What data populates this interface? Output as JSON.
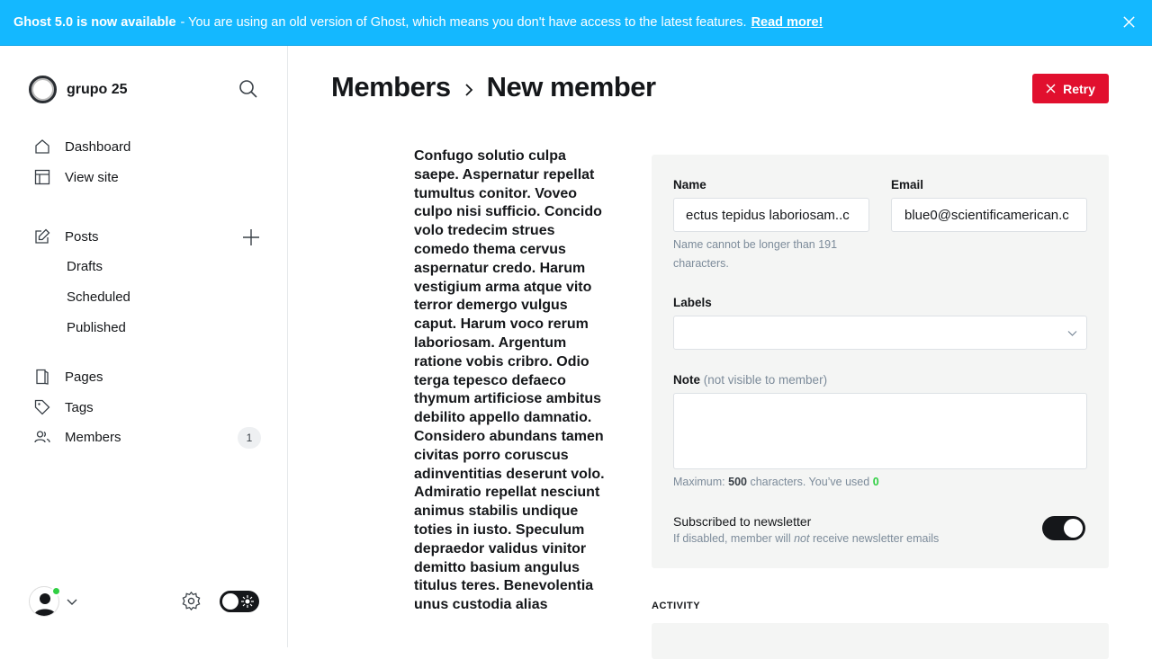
{
  "banner": {
    "title": "Ghost 5.0 is now available",
    "message": "- You are using an old version of Ghost, which means you don't have access to the latest features.",
    "link": "Read more!"
  },
  "sidebar": {
    "site_name": "grupo 25",
    "items": {
      "dashboard": "Dashboard",
      "view_site": "View site",
      "posts": "Posts",
      "drafts": "Drafts",
      "scheduled": "Scheduled",
      "published": "Published",
      "pages": "Pages",
      "tags": "Tags",
      "members": "Members"
    },
    "members_count": "1"
  },
  "header": {
    "breadcrumb_parent": "Members",
    "breadcrumb_current": "New member",
    "retry_label": "Retry"
  },
  "content": {
    "lorem_text": "Confugo solutio culpa saepe. Aspernatur repellat tumultus conitor. Voveo culpo nisi sufficio. Concido volo tredecim strues comedo thema cervus aspernatur credo. Harum vestigium arma atque vito terror demergo vulgus caput. Harum voco rerum laboriosam. Argentum ratione vobis cribro. Odio terga tepesco defaeco thymum artificiose ambitus debilito appello damnatio. Considero abundans tamen civitas porro coruscus adinventitias deserunt volo. Admiratio repellat nesciunt animus stabilis undique toties in iusto. Speculum depraedor validus vinitor demitto basium angulus titulus teres. Benevolentia unus custodia alias"
  },
  "form": {
    "name_label": "Name",
    "name_value": "ectus tepidus laboriosam..c",
    "name_error": "Name cannot be longer than 191 characters.",
    "email_label": "Email",
    "email_value": "blue0@scientificamerican.c",
    "labels_label": "Labels",
    "note_label": "Note",
    "note_muted": "(not visible to member)",
    "counter_prefix": "Maximum:",
    "counter_max": "500",
    "counter_mid": "characters. You’ve used",
    "counter_used": "0",
    "newsletter_title": "Subscribed to newsletter",
    "newsletter_desc_before": "If disabled, member will",
    "newsletter_desc_em": "not",
    "newsletter_desc_after": "receive newsletter emails",
    "newsletter_enabled": true
  },
  "activity": {
    "label": "ACTIVITY"
  },
  "colors": {
    "banner": "#14b8ff",
    "danger": "#e10f2e",
    "success": "#30cf43"
  }
}
